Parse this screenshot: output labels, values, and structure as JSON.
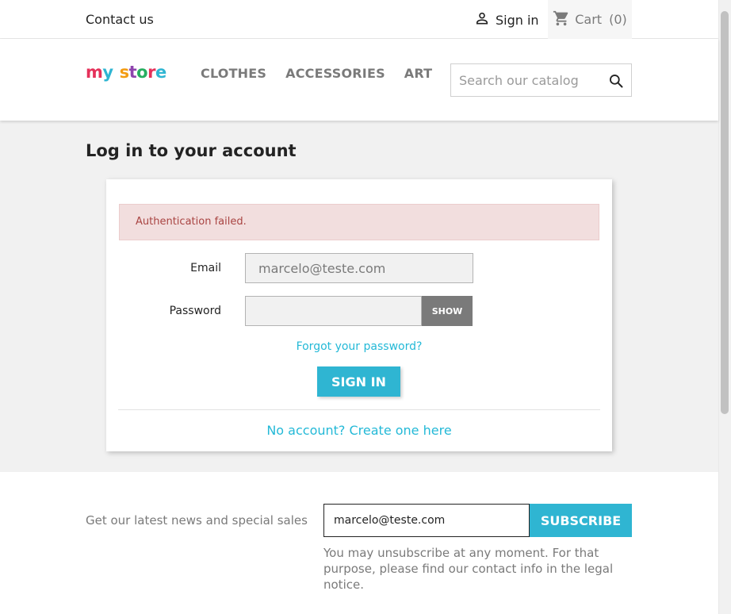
{
  "topbar": {
    "contact_label": "Contact us",
    "signin_label": "Sign in",
    "cart_label": "Cart",
    "cart_count": "(0)"
  },
  "header": {
    "logo": {
      "word1": "my",
      "word2": "store",
      "colors": [
        "#e5315a",
        "#2fb5d2",
        "#f39c12",
        "#8e44ad",
        "#27ae60",
        "#e5315a",
        "#2fb5d2"
      ]
    },
    "menu": [
      {
        "label": "CLOTHES"
      },
      {
        "label": "ACCESSORIES"
      },
      {
        "label": "ART"
      }
    ],
    "search": {
      "placeholder": "Search our catalog",
      "icon": "search-icon"
    }
  },
  "main": {
    "title": "Log in to your account",
    "alert": "Authentication failed.",
    "email": {
      "label": "Email",
      "value": "marcelo@teste.com"
    },
    "password": {
      "label": "Password",
      "value": "",
      "show_label": "SHOW"
    },
    "forgot_label": "Forgot your password?",
    "signin_button_label": "SIGN IN",
    "create_account_label": "No account? Create one here"
  },
  "newsletter": {
    "text": "Get our latest news and special sales",
    "input_value": "marcelo@teste.com",
    "subscribe_label": "SUBSCRIBE",
    "note": "You may unsubscribe at any moment. For that purpose, please find our contact info in the legal notice."
  },
  "colors": {
    "accent": "#2fb5d2",
    "link": "#24b9d7",
    "alert_bg": "#f2dede",
    "alert_text": "#a94442",
    "muted": "#7a7a7a",
    "main_bg": "#f1f1f1"
  }
}
